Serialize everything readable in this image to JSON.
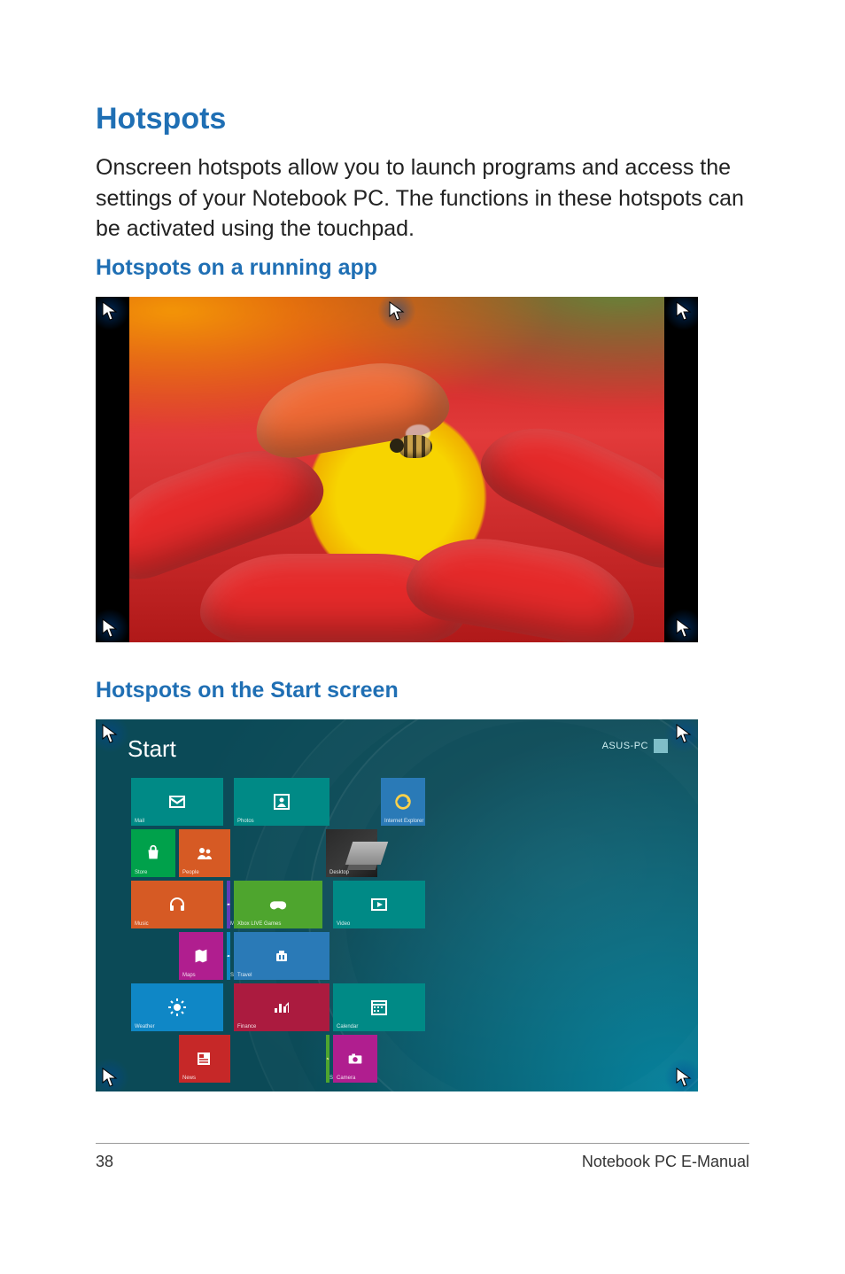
{
  "title": "Hotspots",
  "intro": "Onscreen hotspots allow you to launch programs and access the settings of your Notebook PC. The functions in these hotspots can be activated using the touchpad.",
  "sub1": "Hotspots on a running app",
  "sub2": "Hotspots on the Start screen",
  "start": {
    "header": "Start",
    "user": "ASUS-PC",
    "tiles": {
      "mail": {
        "label": "Mail"
      },
      "people_photo": {
        "label": "Photos"
      },
      "ie": {
        "label": "Internet Explorer"
      },
      "store": {
        "label": "Store"
      },
      "people": {
        "label": "People"
      },
      "desktop": {
        "label": "Desktop"
      },
      "music": {
        "label": "Music"
      },
      "messaging": {
        "label": "Messaging"
      },
      "games": {
        "label": "Xbox LIVE Games"
      },
      "video": {
        "label": "Video"
      },
      "maps": {
        "label": "Maps"
      },
      "skydrive": {
        "label": "SkyDrive"
      },
      "travel": {
        "label": "Travel"
      },
      "weather": {
        "label": "Weather"
      },
      "finance": {
        "label": "Finance"
      },
      "calendar": {
        "label": "Calendar"
      },
      "news": {
        "label": "News"
      },
      "sports": {
        "label": "Sports"
      },
      "camera": {
        "label": "Camera"
      }
    }
  },
  "footer": {
    "page": "38",
    "doc": "Notebook PC E-Manual"
  }
}
